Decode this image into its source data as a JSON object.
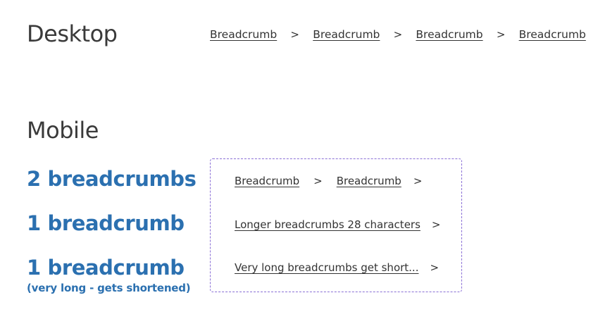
{
  "desktop": {
    "heading": "Desktop",
    "breadcrumbs": [
      "Breadcrumb",
      "Breadcrumb",
      "Breadcrumb",
      "Breadcrumb"
    ],
    "separator": ">"
  },
  "mobile": {
    "heading": "Mobile",
    "separator": ">",
    "examples": [
      {
        "label": "2 breadcrumbs",
        "breadcrumbs": [
          "Breadcrumb",
          "Breadcrumb"
        ]
      },
      {
        "label": "1 breadcrumb",
        "breadcrumbs": [
          "Longer breadcrumbs 28 characters"
        ]
      },
      {
        "label": "1 breadcrumb",
        "sublabel": "(very long - gets shortened)",
        "breadcrumbs": [
          "Very long breadcrumbs get short..."
        ]
      }
    ]
  },
  "colors": {
    "label_blue": "#2b70b0",
    "frame_dashed": "#8a6fd6",
    "text_dark": "#333333"
  }
}
